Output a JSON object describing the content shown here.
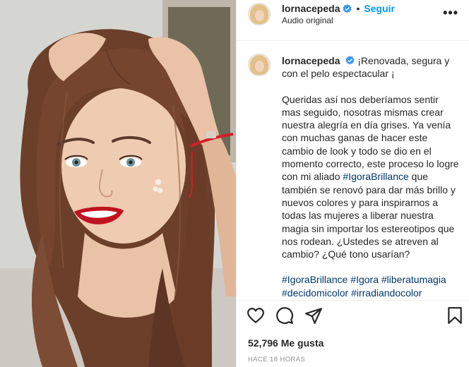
{
  "header": {
    "username": "lornacepeda",
    "separator": "•",
    "follow_label": "Seguir",
    "subtitle": "Audio original",
    "more_label": "•••"
  },
  "caption": {
    "username": "lornacepeda",
    "lines": [
      "¡Renovada, segura y con el pelo espectacular ¡",
      "Queridas así nos deberíamos sentir mas seguido, nosotras mismas crear nuestra alegría en día grises. Ya venía con muchas ganas de hacer este cambio de look y todo se dio en el momento correcto, este proceso lo logre con mi aliado ",
      "#IgoraBrillance",
      " que también se renovó para dar más brillo y nuevos colores y para inspirarnos a todas las mujeres a liberar nuestra magia sin importar los estereotipos que nos rodean. ¿Ustedes se atreven al cambio? ¿Qué tono usarían?"
    ],
    "hashtags": [
      "#IgoraBrillance",
      "#Igora",
      "#liberatumagia",
      "#decidomicolor",
      "#irradiandocolor"
    ]
  },
  "stats": {
    "likes": "52,796 Me gusta",
    "time": "HACE 18 HORAS"
  },
  "icons": {
    "like": "heart-icon",
    "comment": "comment-icon",
    "share": "paper-plane-icon",
    "save": "bookmark-icon",
    "verified": "verified-badge-icon"
  },
  "colors": {
    "link": "#0095f6",
    "hashtag": "#00376b",
    "verified": "#3897f0",
    "muted": "#8e8e8e",
    "text": "#262626"
  }
}
